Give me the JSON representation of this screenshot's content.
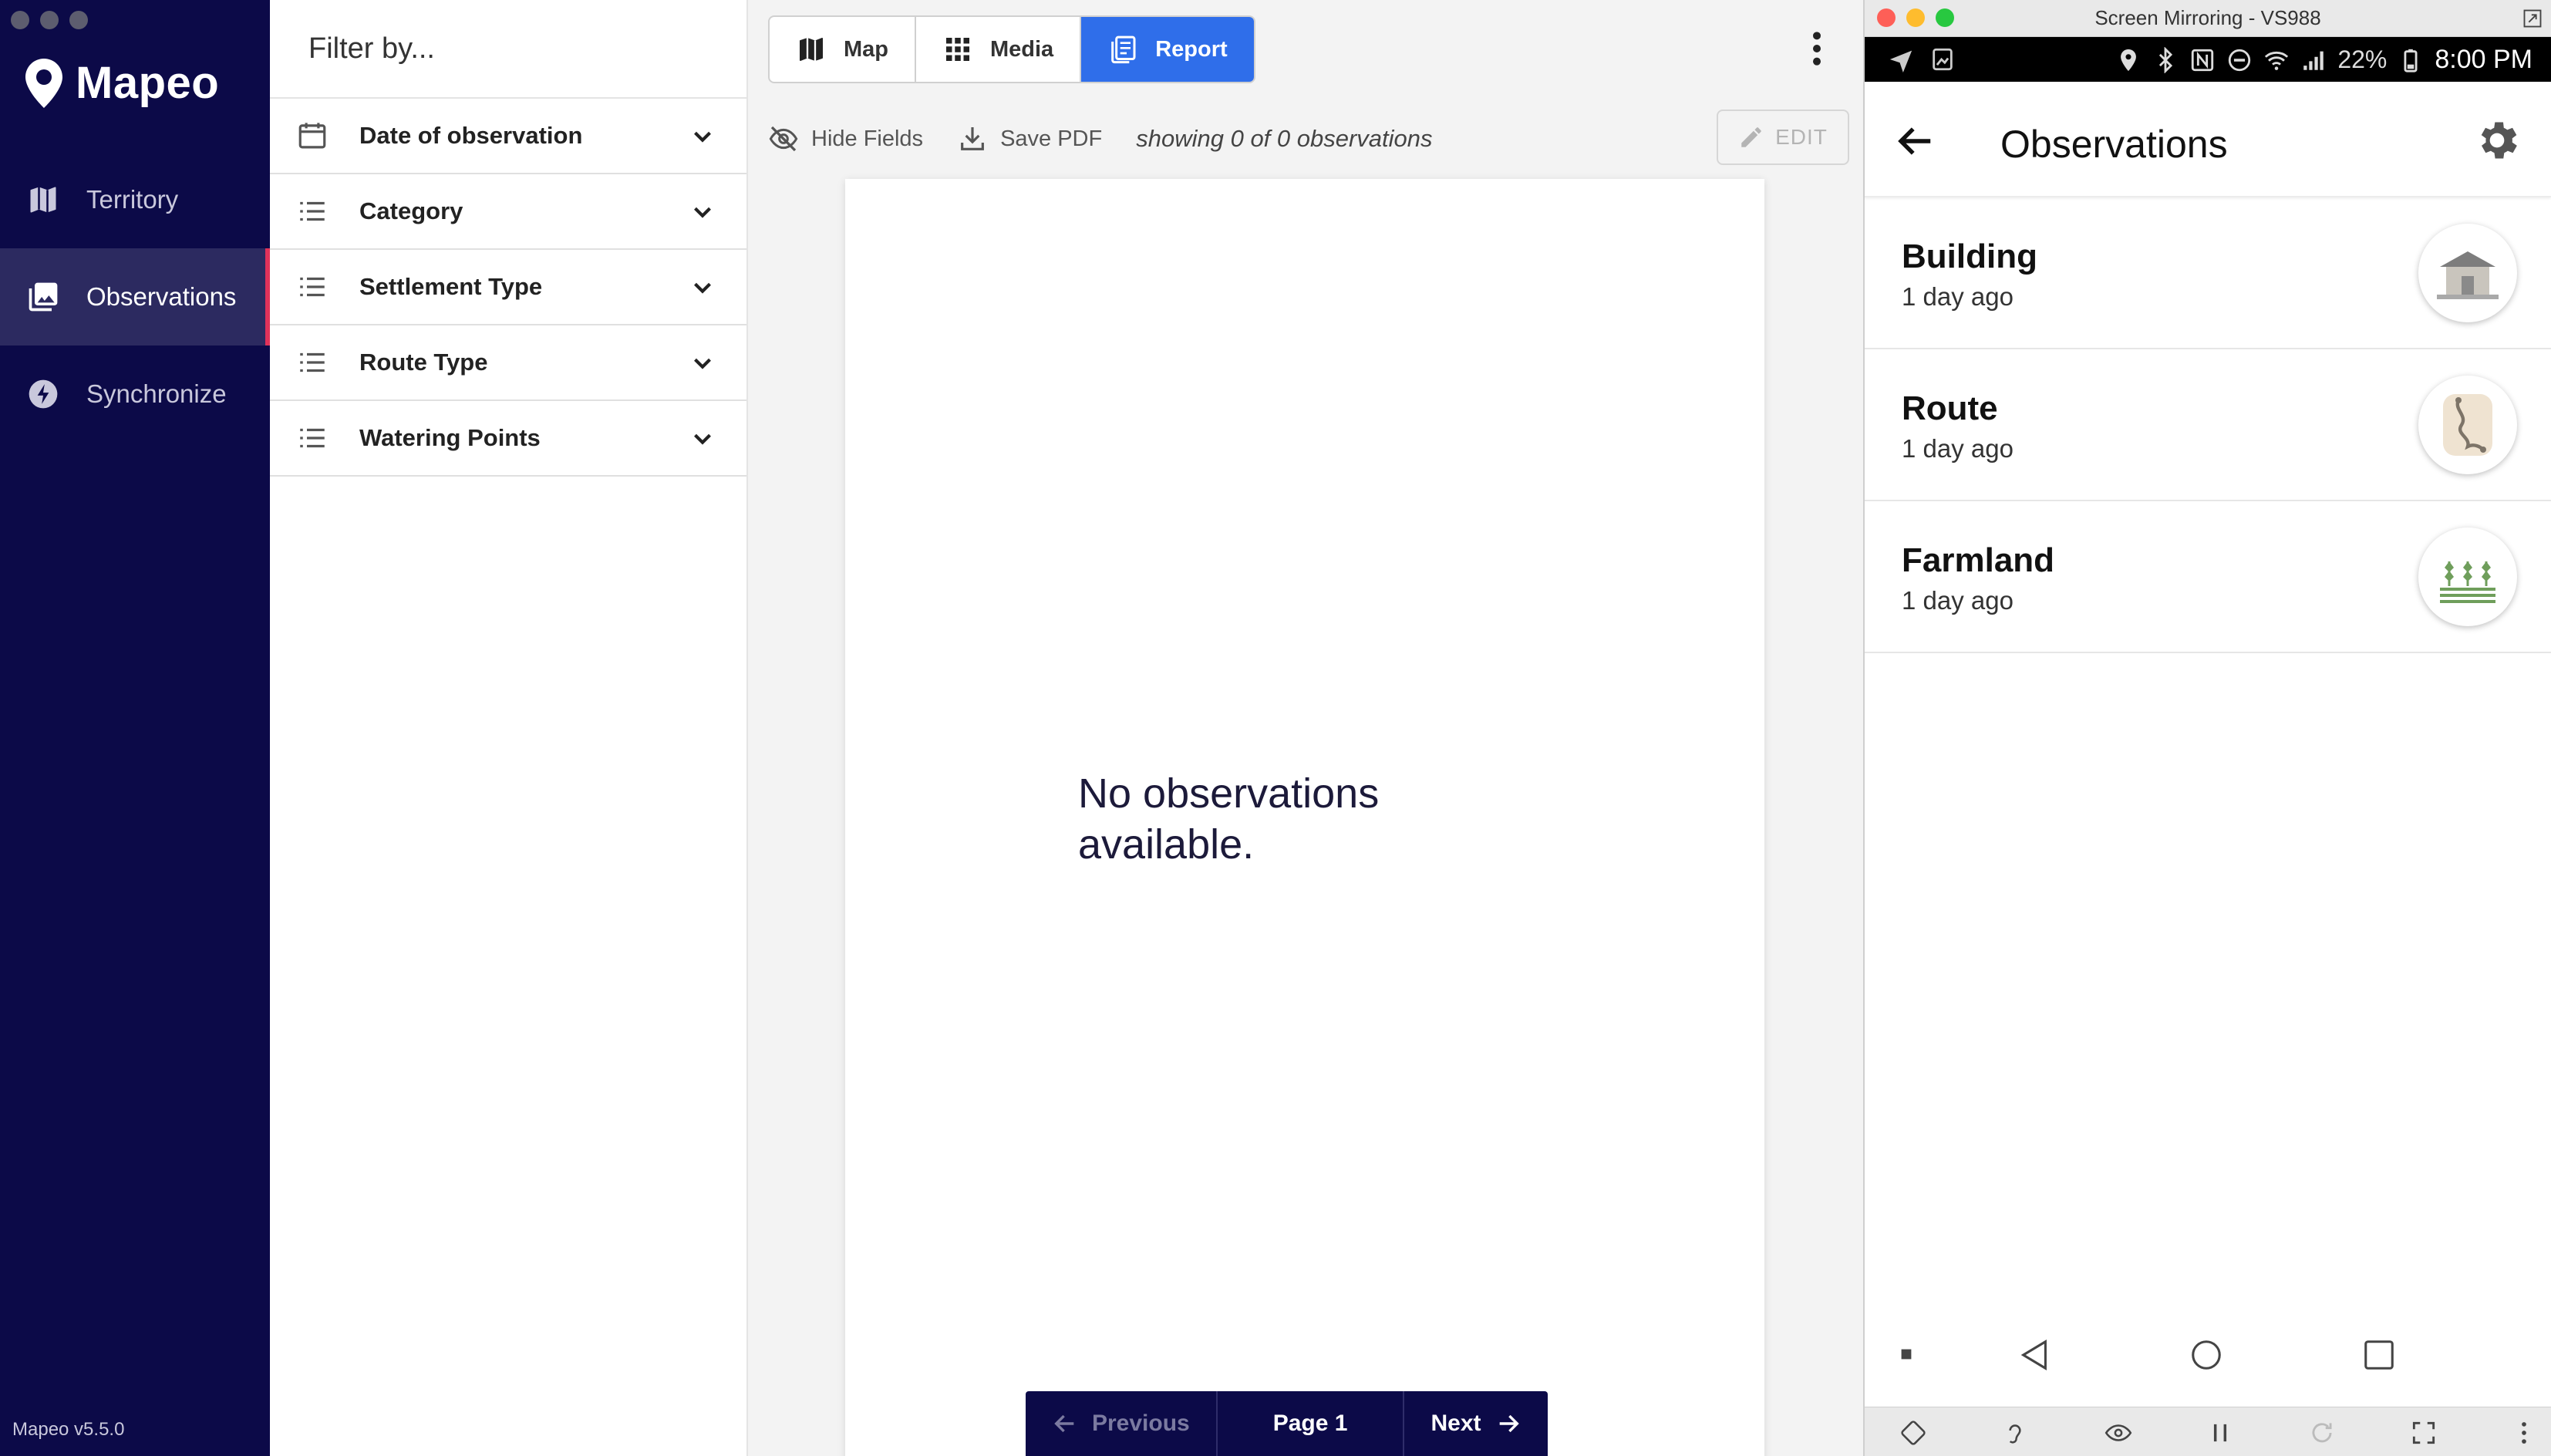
{
  "app": {
    "name": "Mapeo",
    "version": "Mapeo v5.5.0"
  },
  "nav": {
    "items": [
      {
        "label": "Territory",
        "icon": "map-icon"
      },
      {
        "label": "Observations",
        "icon": "photo-library-icon",
        "active": true
      },
      {
        "label": "Synchronize",
        "icon": "lightning-icon"
      }
    ]
  },
  "filter": {
    "header": "Filter by...",
    "items": [
      {
        "label": "Date of observation",
        "icon": "calendar-icon"
      },
      {
        "label": "Category",
        "icon": "list-icon"
      },
      {
        "label": "Settlement Type",
        "icon": "list-icon"
      },
      {
        "label": "Route Type",
        "icon": "list-icon"
      },
      {
        "label": "Watering Points",
        "icon": "list-icon"
      }
    ]
  },
  "main": {
    "tabs": [
      {
        "label": "Map",
        "icon": "map-icon"
      },
      {
        "label": "Media",
        "icon": "grid-icon"
      },
      {
        "label": "Report",
        "icon": "report-icon",
        "active": true
      }
    ],
    "toolbar": {
      "hide_fields": "Hide Fields",
      "save_pdf": "Save PDF",
      "showing": "showing 0 of 0 observations",
      "edit": "EDIT"
    },
    "empty_line1": "No observations",
    "empty_line2": "available.",
    "pager": {
      "previous": "Previous",
      "page": "Page 1",
      "next": "Next"
    }
  },
  "phone": {
    "window_title": "Screen Mirroring - VS988",
    "status": {
      "battery": "22%",
      "time": "8:00 PM"
    },
    "title": "Observations",
    "observations": [
      {
        "name": "Building",
        "time": "1 day ago",
        "icon": "building-icon"
      },
      {
        "name": "Route",
        "time": "1 day ago",
        "icon": "route-icon"
      },
      {
        "name": "Farmland",
        "time": "1 day ago",
        "icon": "farmland-icon"
      }
    ]
  },
  "colors": {
    "nav_bg": "#0c0a48",
    "accent": "#2f6eea",
    "active_marker": "#e0325a"
  }
}
